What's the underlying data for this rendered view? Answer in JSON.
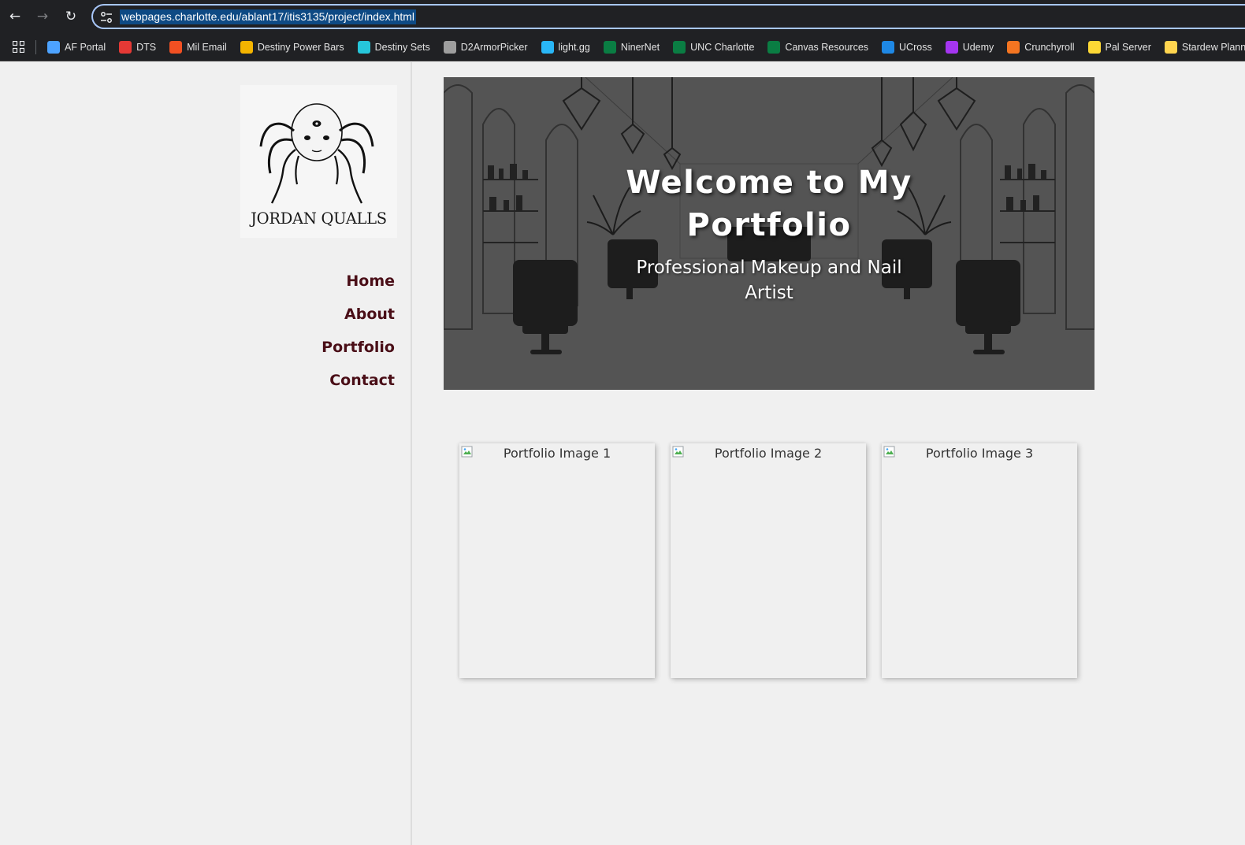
{
  "browser": {
    "url": "webpages.charlotte.edu/ablant17/itis3135/project/index.html",
    "bookmarks": [
      {
        "label": "AF Portal",
        "icon": "af-portal-icon",
        "color": "#4da3ff"
      },
      {
        "label": "DTS",
        "icon": "dts-shield-icon",
        "color": "#e53935"
      },
      {
        "label": "Mil Email",
        "icon": "microsoft-icon",
        "color": "#f25022"
      },
      {
        "label": "Destiny Power Bars",
        "icon": "bar-chart-icon",
        "color": "#f4b400"
      },
      {
        "label": "Destiny Sets",
        "icon": "diamond-icon",
        "color": "#26c6da"
      },
      {
        "label": "D2ArmorPicker",
        "icon": "gear-icon",
        "color": "#9e9e9e"
      },
      {
        "label": "light.gg",
        "icon": "lightgg-icon",
        "color": "#29b6f6"
      },
      {
        "label": "NinerNet",
        "icon": "niner-icon",
        "color": "#0a7d43"
      },
      {
        "label": "UNC Charlotte",
        "icon": "niner-icon",
        "color": "#0a7d43"
      },
      {
        "label": "Canvas Resources",
        "icon": "niner-icon",
        "color": "#0a7d43"
      },
      {
        "label": "UCross",
        "icon": "cloud-icon",
        "color": "#1e88e5"
      },
      {
        "label": "Udemy",
        "icon": "udemy-icon",
        "color": "#a435f0"
      },
      {
        "label": "Crunchyroll",
        "icon": "crunchyroll-icon",
        "color": "#f47521"
      },
      {
        "label": "Pal Server",
        "icon": "pal-icon",
        "color": "#fdd835"
      },
      {
        "label": "Stardew Planner Duo",
        "icon": "stardew-icon",
        "color": "#ffd54f"
      }
    ]
  },
  "sidebar": {
    "logo_text": "JORDAN QUALLS",
    "nav": [
      "Home",
      "About",
      "Portfolio",
      "Contact"
    ]
  },
  "hero": {
    "title": "Welcome to My Portfolio",
    "subtitle": "Professional Makeup and Nail Artist"
  },
  "gallery": {
    "images": [
      "Portfolio Image 1",
      "Portfolio Image 2",
      "Portfolio Image 3"
    ]
  },
  "colors": {
    "nav_link": "#4a0e17",
    "page_bg": "#f0f0f0",
    "url_highlight": "#0e4a84"
  }
}
